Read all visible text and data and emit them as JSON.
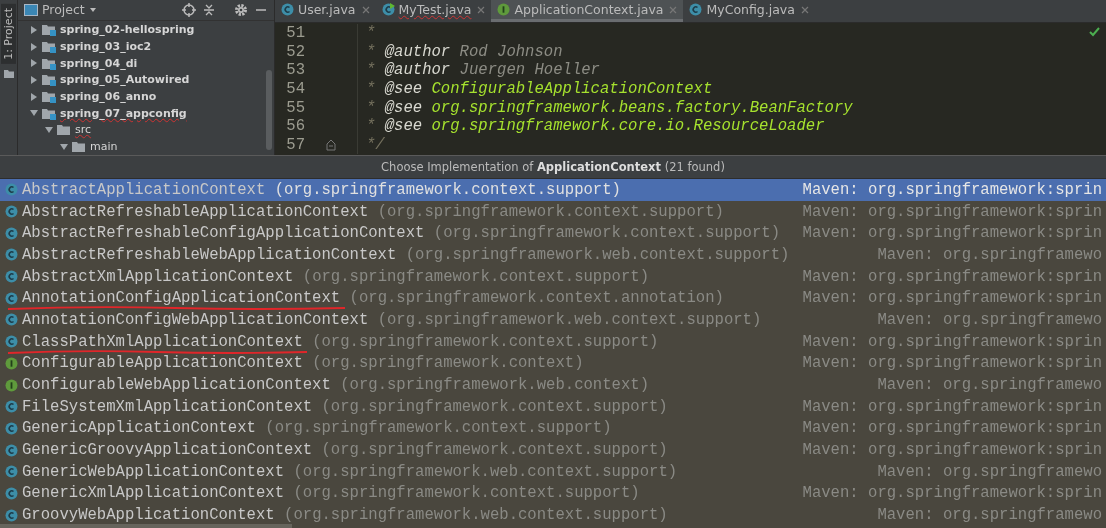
{
  "tool_strip": {
    "label": "1: Project"
  },
  "project_panel": {
    "title": "Project",
    "tree": [
      {
        "label": "spring_02-hellospring",
        "kind": "module",
        "expanded": false,
        "error": false
      },
      {
        "label": "spring_03_ioc2",
        "kind": "module",
        "expanded": false,
        "error": false
      },
      {
        "label": "spring_04_di",
        "kind": "module",
        "expanded": false,
        "error": false
      },
      {
        "label": "spring_05_Autowired",
        "kind": "module",
        "expanded": false,
        "error": false
      },
      {
        "label": "spring_06_anno",
        "kind": "module",
        "expanded": false,
        "error": false
      },
      {
        "label": "spring_07_appconfig",
        "kind": "module",
        "expanded": true,
        "error": true,
        "children": [
          {
            "label": "src",
            "kind": "folder",
            "expanded": true,
            "error": true,
            "children": [
              {
                "label": "main",
                "kind": "folder",
                "expanded": true,
                "error": false
              }
            ]
          }
        ]
      }
    ]
  },
  "editor": {
    "tabs": [
      {
        "label": "User.java",
        "kind": "class",
        "selected": false,
        "error": false
      },
      {
        "label": "MyTest.java",
        "kind": "runnable",
        "selected": false,
        "error": true
      },
      {
        "label": "ApplicationContext.java",
        "kind": "interface",
        "selected": true,
        "error": false
      },
      {
        "label": "MyConfig.java",
        "kind": "class",
        "selected": false,
        "error": false
      }
    ],
    "lines": [
      {
        "number": "51",
        "fold": false,
        "segments": [
          {
            "kind": "comment",
            "text": "*"
          }
        ]
      },
      {
        "number": "52",
        "fold": false,
        "segments": [
          {
            "kind": "comment",
            "text": "*"
          },
          {
            "kind": "tag",
            "text": "@author"
          },
          {
            "kind": "value",
            "text": "Rod Johnson"
          }
        ]
      },
      {
        "number": "53",
        "fold": false,
        "segments": [
          {
            "kind": "comment",
            "text": "*"
          },
          {
            "kind": "tag",
            "text": "@author"
          },
          {
            "kind": "value",
            "text": "Juergen Hoeller"
          }
        ]
      },
      {
        "number": "54",
        "fold": false,
        "segments": [
          {
            "kind": "comment",
            "text": "*"
          },
          {
            "kind": "tag",
            "text": "@see"
          },
          {
            "kind": "ref",
            "text": "ConfigurableApplicationContext"
          }
        ]
      },
      {
        "number": "55",
        "fold": false,
        "segments": [
          {
            "kind": "comment",
            "text": "*"
          },
          {
            "kind": "tag",
            "text": "@see"
          },
          {
            "kind": "ref",
            "text": "org.springframework.beans.factory.BeanFactory"
          }
        ]
      },
      {
        "number": "56",
        "fold": false,
        "segments": [
          {
            "kind": "comment",
            "text": "*"
          },
          {
            "kind": "tag",
            "text": "@see"
          },
          {
            "kind": "ref",
            "text": "org.springframework.core.io.ResourceLoader"
          }
        ]
      },
      {
        "number": "57",
        "fold": true,
        "segments": [
          {
            "kind": "comment",
            "text": "*/"
          }
        ]
      }
    ]
  },
  "popup": {
    "title": "Choose Implementation of **ApplicationContext** (21 found)",
    "rows": [
      {
        "kind": "class",
        "name": "AbstractApplicationContext",
        "package": "(org.springframework.context.support)",
        "location": "Maven: org.springframework:sprin",
        "selected": true,
        "underlined": false
      },
      {
        "kind": "class",
        "name": "AbstractRefreshableApplicationContext",
        "package": "(org.springframework.context.support)",
        "location": "Maven: org.springframework:sprin",
        "selected": false,
        "underlined": false
      },
      {
        "kind": "class",
        "name": "AbstractRefreshableConfigApplicationContext",
        "package": "(org.springframework.context.support)",
        "location": "Maven: org.springframework:sprin",
        "selected": false,
        "underlined": false
      },
      {
        "kind": "class",
        "name": "AbstractRefreshableWebApplicationContext",
        "package": "(org.springframework.web.context.support)",
        "location": "Maven: org.springframewo",
        "selected": false,
        "underlined": false
      },
      {
        "kind": "class",
        "name": "AbstractXmlApplicationContext",
        "package": "(org.springframework.context.support)",
        "location": "Maven: org.springframework:sprin",
        "selected": false,
        "underlined": false
      },
      {
        "kind": "class",
        "name": "AnnotationConfigApplicationContext",
        "package": "(org.springframework.context.annotation)",
        "location": "Maven: org.springframework:sprin",
        "selected": false,
        "underlined": true
      },
      {
        "kind": "class",
        "name": "AnnotationConfigWebApplicationContext",
        "package": "(org.springframework.web.context.support)",
        "location": "Maven: org.springframewo",
        "selected": false,
        "underlined": false
      },
      {
        "kind": "class",
        "name": "ClassPathXmlApplicationContext",
        "package": "(org.springframework.context.support)",
        "location": "Maven: org.springframework:sprin",
        "selected": false,
        "underlined": true
      },
      {
        "kind": "interface",
        "name": "ConfigurableApplicationContext",
        "package": "(org.springframework.context)",
        "location": "Maven: org.springframework:sprin",
        "selected": false,
        "underlined": false
      },
      {
        "kind": "interface",
        "name": "ConfigurableWebApplicationContext",
        "package": "(org.springframework.web.context)",
        "location": "Maven: org.springframewo",
        "selected": false,
        "underlined": false
      },
      {
        "kind": "class",
        "name": "FileSystemXmlApplicationContext",
        "package": "(org.springframework.context.support)",
        "location": "Maven: org.springframework:sprin",
        "selected": false,
        "underlined": false
      },
      {
        "kind": "class",
        "name": "GenericApplicationContext",
        "package": "(org.springframework.context.support)",
        "location": "Maven: org.springframework:sprin",
        "selected": false,
        "underlined": false
      },
      {
        "kind": "class",
        "name": "GenericGroovyApplicationContext",
        "package": "(org.springframework.context.support)",
        "location": "Maven: org.springframework:sprin",
        "selected": false,
        "underlined": false
      },
      {
        "kind": "class",
        "name": "GenericWebApplicationContext",
        "package": "(org.springframework.web.context.support)",
        "location": "Maven: org.springframewo",
        "selected": false,
        "underlined": false
      },
      {
        "kind": "class",
        "name": "GenericXmlApplicationContext",
        "package": "(org.springframework.context.support)",
        "location": "Maven: org.springframework:sprin",
        "selected": false,
        "underlined": false
      },
      {
        "kind": "class",
        "name": "GroovyWebApplicationContext",
        "package": "(org.springframework.web.context.support)",
        "location": "Maven: org.springframewo",
        "selected": false,
        "underlined": false
      }
    ]
  }
}
